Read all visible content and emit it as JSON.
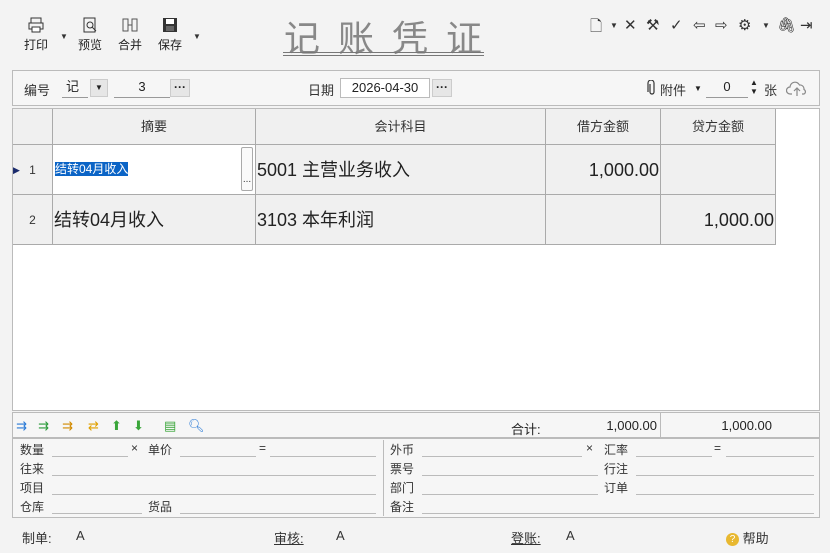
{
  "toolbar": {
    "print": "打印",
    "preview": "预览",
    "merge": "合并",
    "save": "保存"
  },
  "title": "记账凭证",
  "header": {
    "number_label": "编号",
    "voucher_type": "记",
    "voucher_number": "3",
    "date_label": "日期",
    "date": "2026-04-30",
    "attachment_label": "附件",
    "attachment_count": "0",
    "attachment_unit": "张",
    "more": "···"
  },
  "grid": {
    "headers": [
      "摘要",
      "会计科目",
      "借方金额",
      "贷方金额"
    ],
    "rows": [
      {
        "num": "1",
        "summary": "结转04月收入",
        "account": "5001 主营业务收入",
        "debit": "1,000.00",
        "credit": ""
      },
      {
        "num": "2",
        "summary": "结转04月收入",
        "account": "3103 本年利润",
        "debit": "",
        "credit": "1,000.00"
      }
    ],
    "ellipsis": "..."
  },
  "totals": {
    "label": "合计:",
    "debit": "1,000.00",
    "credit": "1,000.00"
  },
  "aux": {
    "quantity": "数量",
    "times": "×",
    "unit_price": "单价",
    "equals": "=",
    "counterparty": "往来",
    "project": "项目",
    "warehouse": "仓库",
    "goods": "货品",
    "currency": "外币",
    "times2": "×",
    "rate": "汇率",
    "equals2": "=",
    "ticket_no": "票号",
    "bank": "行注",
    "department": "部门",
    "order": "订单",
    "remark": "备注"
  },
  "footer": {
    "maker_label": "制单:",
    "maker": "A",
    "reviewer_label": "审核:",
    "reviewer": "A",
    "poster_label": "登账:",
    "poster": "A",
    "help": "帮助"
  }
}
